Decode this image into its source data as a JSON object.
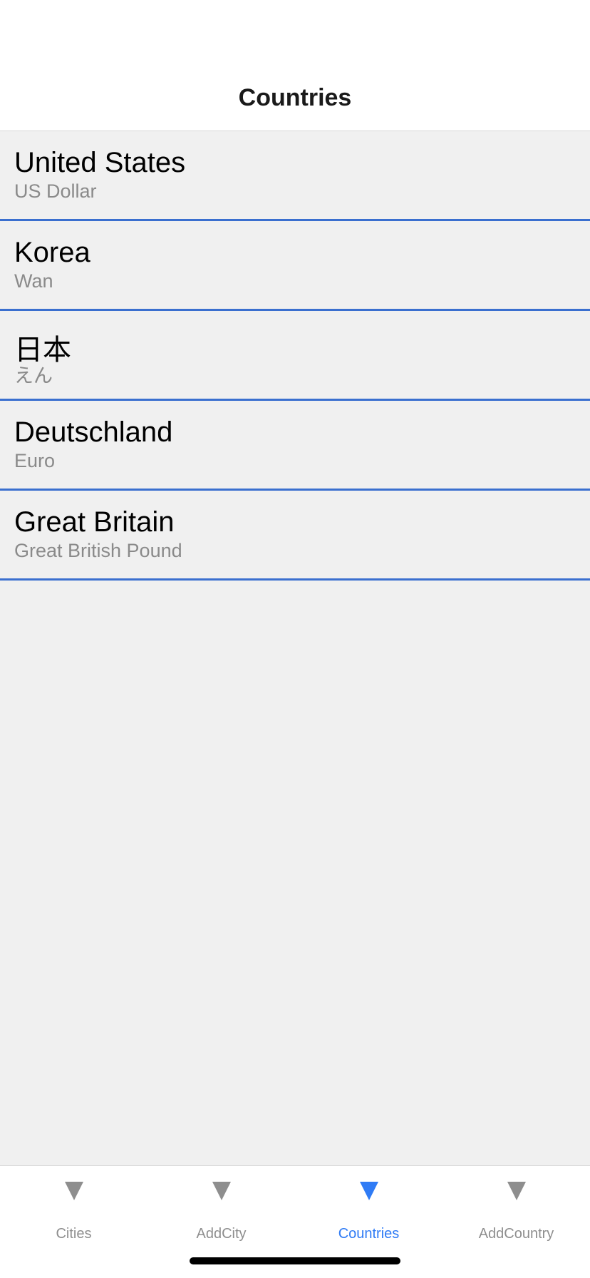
{
  "header": {
    "title": "Countries"
  },
  "countries": [
    {
      "name": "United States",
      "currency": "US Dollar"
    },
    {
      "name": "Korea",
      "currency": "Wan"
    },
    {
      "name": "日本",
      "currency": "えん"
    },
    {
      "name": "Deutschland",
      "currency": "Euro"
    },
    {
      "name": "Great Britain",
      "currency": "Great British Pound"
    }
  ],
  "tabbar": {
    "tabs": [
      {
        "label": "Cities",
        "icon": "triangle-down-icon",
        "active": false
      },
      {
        "label": "AddCity",
        "icon": "triangle-down-icon",
        "active": false
      },
      {
        "label": "Countries",
        "icon": "triangle-down-icon",
        "active": true
      },
      {
        "label": "AddCountry",
        "icon": "triangle-down-icon",
        "active": false
      }
    ]
  },
  "colors": {
    "accent": "#2f7bf5",
    "separator": "#3a6fcf",
    "background": "#f0f0f0"
  }
}
